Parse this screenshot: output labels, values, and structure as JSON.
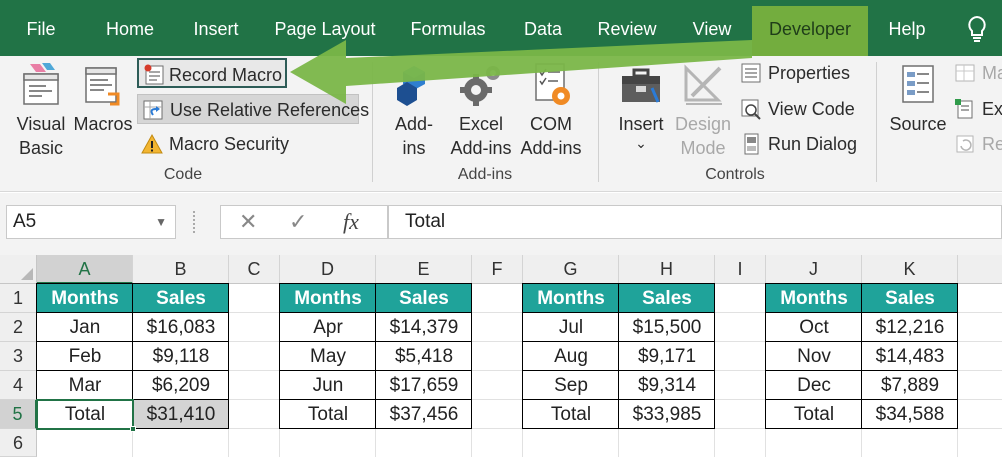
{
  "tabs": [
    "File",
    "Home",
    "Insert",
    "Page Layout",
    "Formulas",
    "Data",
    "Review",
    "View",
    "Developer",
    "Help"
  ],
  "active_tab": "Developer",
  "ribbon": {
    "code": {
      "visual_basic": "Visual Basic",
      "visual_basic_l1": "Visual",
      "visual_basic_l2": "Basic",
      "macros": "Macros",
      "record_macro": "Record Macro",
      "use_relative": "Use Relative References",
      "macro_security": "Macro Security",
      "group": "Code"
    },
    "addins": {
      "addins_l1": "Add-",
      "addins_l2": "ins",
      "excel_l1": "Excel",
      "excel_l2": "Add-ins",
      "com_l1": "COM",
      "com_l2": "Add-ins",
      "group": "Add-ins"
    },
    "controls": {
      "insert": "Insert",
      "insert_caret": "⌄",
      "design_l1": "Design",
      "design_l2": "Mode",
      "properties": "Properties",
      "view_code": "View Code",
      "run_dialog": "Run Dialog",
      "group": "Controls"
    },
    "xml": {
      "source": "Source",
      "map": "Ma",
      "expansion": "Exp",
      "refresh": "Ref"
    }
  },
  "formula_bar": {
    "name_box": "A5",
    "cancel": "✕",
    "enter": "✓",
    "fx": "fx",
    "formula": "Total"
  },
  "columns": [
    "A",
    "B",
    "C",
    "D",
    "E",
    "F",
    "G",
    "H",
    "I",
    "J",
    "K"
  ],
  "rows": [
    "1",
    "2",
    "3",
    "4",
    "5",
    "6"
  ],
  "selected_cell": "A5",
  "colors": {
    "excel_green": "#217346",
    "developer_tab": "#73ad3e",
    "header_teal": "#1fa39a",
    "arrow_green": "#7ab648"
  },
  "tables": [
    {
      "headers": [
        "Months",
        "Sales"
      ],
      "rows": [
        [
          "Jan",
          "$16,083"
        ],
        [
          "Feb",
          "$9,118"
        ],
        [
          "Mar",
          "$6,209"
        ],
        [
          "Total",
          "$31,410"
        ]
      ]
    },
    {
      "headers": [
        "Months",
        "Sales"
      ],
      "rows": [
        [
          "Apr",
          "$14,379"
        ],
        [
          "May",
          "$5,418"
        ],
        [
          "Jun",
          "$17,659"
        ],
        [
          "Total",
          "$37,456"
        ]
      ]
    },
    {
      "headers": [
        "Months",
        "Sales"
      ],
      "rows": [
        [
          "Jul",
          "$15,500"
        ],
        [
          "Aug",
          "$9,171"
        ],
        [
          "Sep",
          "$9,314"
        ],
        [
          "Total",
          "$33,985"
        ]
      ]
    },
    {
      "headers": [
        "Months",
        "Sales"
      ],
      "rows": [
        [
          "Oct",
          "$12,216"
        ],
        [
          "Nov",
          "$14,483"
        ],
        [
          "Dec",
          "$7,889"
        ],
        [
          "Total",
          "$34,588"
        ]
      ]
    }
  ]
}
